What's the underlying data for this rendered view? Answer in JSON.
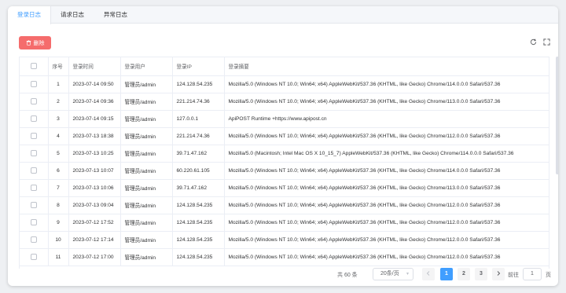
{
  "tabs": [
    {
      "label": "登录日志",
      "active": true
    },
    {
      "label": "请求日志",
      "active": false
    },
    {
      "label": "异常日志",
      "active": false
    }
  ],
  "toolbar": {
    "delete_label": "删除"
  },
  "table": {
    "headers": [
      "序号",
      "登录时间",
      "登录用户",
      "登录IP",
      "登录摘要"
    ],
    "rows": [
      [
        "1",
        "2023-07-14 09:50",
        "管理员/admin",
        "124.128.54.235",
        "Mozilla/5.0 (Windows NT 10.0; Win64; x64) AppleWebKit/537.36 (KHTML, like Gecko) Chrome/114.0.0.0 Safari/537.36"
      ],
      [
        "2",
        "2023-07-14 09:36",
        "管理员/admin",
        "221.214.74.36",
        "Mozilla/5.0 (Windows NT 10.0; Win64; x64) AppleWebKit/537.36 (KHTML, like Gecko) Chrome/113.0.0.0 Safari/537.36"
      ],
      [
        "3",
        "2023-07-14 09:15",
        "管理员/admin",
        "127.0.0.1",
        "ApiPOST Runtime +https://www.apipost.cn"
      ],
      [
        "4",
        "2023-07-13 18:38",
        "管理员/admin",
        "221.214.74.36",
        "Mozilla/5.0 (Windows NT 10.0; Win64; x64) AppleWebKit/537.36 (KHTML, like Gecko) Chrome/112.0.0.0 Safari/537.36"
      ],
      [
        "5",
        "2023-07-13 10:25",
        "管理员/admin",
        "39.71.47.162",
        "Mozilla/5.0 (Macintosh; Intel Mac OS X 10_15_7) AppleWebKit/537.36 (KHTML, like Gecko) Chrome/114.0.0.0 Safari/537.36"
      ],
      [
        "6",
        "2023-07-13 10:07",
        "管理员/admin",
        "60.220.61.105",
        "Mozilla/5.0 (Windows NT 10.0; Win64; x64) AppleWebKit/537.36 (KHTML, like Gecko) Chrome/114.0.0.0 Safari/537.36"
      ],
      [
        "7",
        "2023-07-13 10:06",
        "管理员/admin",
        "39.71.47.162",
        "Mozilla/5.0 (Windows NT 10.0; Win64; x64) AppleWebKit/537.36 (KHTML, like Gecko) Chrome/113.0.0.0 Safari/537.36"
      ],
      [
        "8",
        "2023-07-13 09:04",
        "管理员/admin",
        "124.128.54.235",
        "Mozilla/5.0 (Windows NT 10.0; Win64; x64) AppleWebKit/537.36 (KHTML, like Gecko) Chrome/112.0.0.0 Safari/537.36"
      ],
      [
        "9",
        "2023-07-12 17:52",
        "管理员/admin",
        "124.128.54.235",
        "Mozilla/5.0 (Windows NT 10.0; Win64; x64) AppleWebKit/537.36 (KHTML, like Gecko) Chrome/112.0.0.0 Safari/537.36"
      ],
      [
        "10",
        "2023-07-12 17:14",
        "管理员/admin",
        "124.128.54.235",
        "Mozilla/5.0 (Windows NT 10.0; Win64; x64) AppleWebKit/537.36 (KHTML, like Gecko) Chrome/112.0.0.0 Safari/537.36"
      ],
      [
        "11",
        "2023-07-12 17:00",
        "管理员/admin",
        "124.128.54.235",
        "Mozilla/5.0 (Windows NT 10.0; Win64; x64) AppleWebKit/537.36 (KHTML, like Gecko) Chrome/112.0.0.0 Safari/537.36"
      ]
    ]
  },
  "pagination": {
    "total_text": "共 60 条",
    "page_size": "20条/页",
    "pages": [
      "1",
      "2",
      "3"
    ],
    "current_page": "1",
    "prev_icon": "chevron-left-icon",
    "next_icon": "chevron-right-icon",
    "goto_prefix": "前往",
    "goto_value": "1",
    "goto_suffix": "页"
  },
  "icons": {
    "delete": "trash-icon",
    "refresh": "refresh-icon",
    "fullscreen": "fullscreen-icon"
  },
  "colors": {
    "accent": "#409eff",
    "danger": "#f56c6c"
  }
}
